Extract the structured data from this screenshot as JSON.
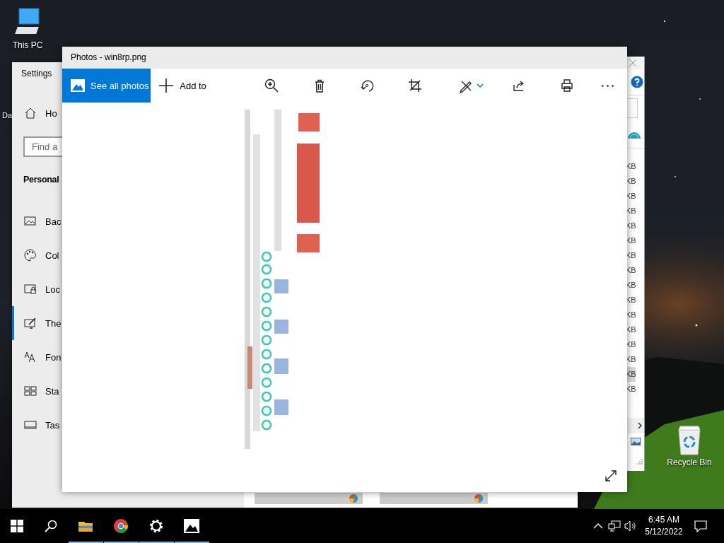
{
  "desktop": {
    "icons": [
      {
        "kind": "pc",
        "label": "This PC"
      },
      {
        "kind": "partial",
        "label": "Da"
      },
      {
        "kind": "bin",
        "label": "Recycle Bin"
      }
    ]
  },
  "settings": {
    "title": "Settings",
    "home": "Ho",
    "search": {
      "placeholder": "Find a"
    },
    "section": "Personal",
    "items": [
      {
        "kind": "background",
        "label": "Bac",
        "selected": false
      },
      {
        "kind": "colors",
        "label": "Col",
        "selected": false
      },
      {
        "kind": "lock",
        "label": "Loc",
        "selected": false
      },
      {
        "kind": "themes",
        "label": "The",
        "selected": true
      },
      {
        "kind": "fonts",
        "label": "Fon",
        "selected": false
      },
      {
        "kind": "start",
        "label": "Sta",
        "selected": false
      },
      {
        "kind": "taskbar",
        "label": "Tas",
        "selected": false
      }
    ]
  },
  "explorer": {
    "rows": [
      {
        "size": "KB",
        "selected": false
      },
      {
        "size": "KB",
        "selected": false
      },
      {
        "size": "KB",
        "selected": false
      },
      {
        "size": "KB",
        "selected": false
      },
      {
        "size": "KB",
        "selected": false
      },
      {
        "size": "KB",
        "selected": false
      },
      {
        "size": "KB",
        "selected": false
      },
      {
        "size": "KB",
        "selected": false
      },
      {
        "size": "KB",
        "selected": false
      },
      {
        "size": "KB",
        "selected": false
      },
      {
        "size": "KB",
        "selected": false
      },
      {
        "size": "KB",
        "selected": false
      },
      {
        "size": "KB",
        "selected": false
      },
      {
        "size": "KB",
        "selected": false
      },
      {
        "size": "KB",
        "selected": true
      },
      {
        "size": "KB",
        "selected": false
      }
    ]
  },
  "photos": {
    "title": "Photos - win8rp.png",
    "see_all": "See all photos",
    "add_to": "Add to",
    "tools": [
      {
        "kind": "zoom"
      },
      {
        "kind": "delete"
      },
      {
        "kind": "rotate"
      },
      {
        "kind": "crop"
      },
      {
        "kind": "edit"
      },
      {
        "kind": "share"
      },
      {
        "kind": "print"
      },
      {
        "kind": "more"
      }
    ]
  },
  "taskbar": {
    "apps": [
      {
        "kind": "explorer",
        "running": true
      },
      {
        "kind": "chrome",
        "running": true
      },
      {
        "kind": "settings",
        "running": true
      },
      {
        "kind": "photos",
        "running": true
      }
    ],
    "time": "6:45 AM",
    "date": "5/12/2022"
  }
}
